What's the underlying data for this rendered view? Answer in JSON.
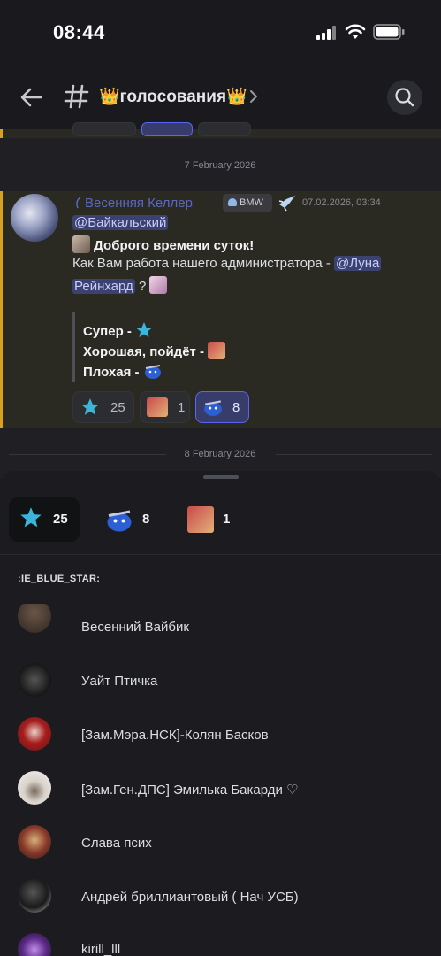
{
  "status_bar": {
    "time": "08:44"
  },
  "header": {
    "channel_name": "👑голосования👑"
  },
  "chat": {
    "date_1": "7 February 2026",
    "date_2": "8 February 2026",
    "message": {
      "author": "Весенняя Келлер",
      "tag": "BMW",
      "timestamp": "07.02.2026, 03:34",
      "mention_1": "@Байкальский",
      "greeting": "Доброго времени суток!",
      "question_part1": "Как Вам работа нашего администратора -",
      "mention_2_part1": "@Луна",
      "mention_2_part2": "Рейнхард",
      "question_mark": "?",
      "options": [
        "Супер -",
        "Хорошая, пойдёт -",
        "Плохая -"
      ],
      "reactions": [
        {
          "emoji": "blue-star",
          "count": "25"
        },
        {
          "emoji": "cat",
          "count": "1"
        },
        {
          "emoji": "blue-blob",
          "count": "8"
        }
      ]
    }
  },
  "reactions_sheet": {
    "tabs": [
      {
        "emoji": "blue-star",
        "count": "25"
      },
      {
        "emoji": "blue-blob",
        "count": "8"
      },
      {
        "emoji": "cat",
        "count": "1"
      }
    ],
    "section_title": ":IE_BLUE_STAR:",
    "users": [
      "Весенний Вайбик",
      "Уайт Птичка",
      "[Зам.Мэра.НСК]-Колян Басков",
      "[Зам.Ген.ДПС] Эмилька Бакарди ♡",
      "Слава псих",
      "Андрей бриллиантовый ( Нач УСБ)",
      "kirill_lll"
    ]
  },
  "colors": {
    "accent": "#5865f2",
    "highlight_bar": "#d6a21f",
    "mention_bg": "#3c4270"
  }
}
